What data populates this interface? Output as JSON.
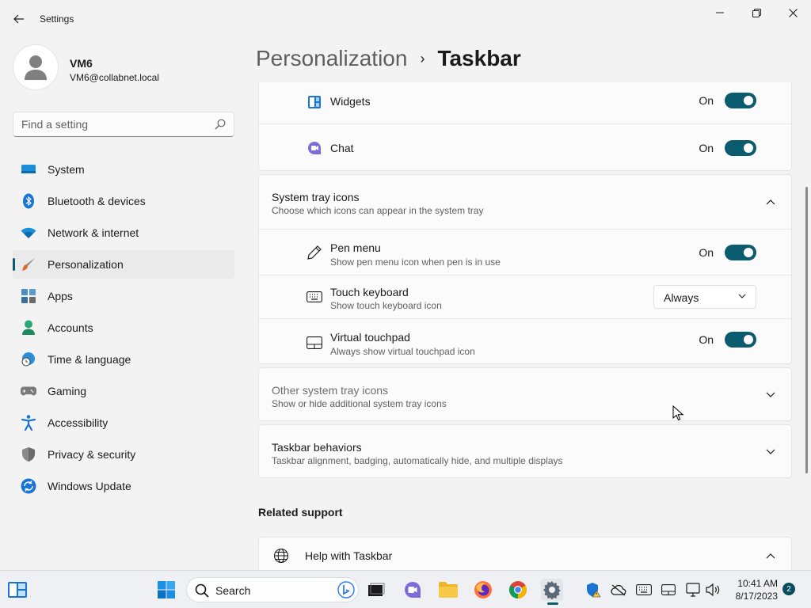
{
  "window": {
    "title": "Settings"
  },
  "profile": {
    "name": "VM6",
    "email": "VM6@collabnet.local"
  },
  "search": {
    "placeholder": "Find a setting"
  },
  "sidebar": {
    "items": [
      {
        "label": "System",
        "icon": "monitor-icon"
      },
      {
        "label": "Bluetooth & devices",
        "icon": "bluetooth-icon"
      },
      {
        "label": "Network & internet",
        "icon": "wifi-icon"
      },
      {
        "label": "Personalization",
        "icon": "brush-icon",
        "active": true
      },
      {
        "label": "Apps",
        "icon": "apps-icon"
      },
      {
        "label": "Accounts",
        "icon": "person-icon"
      },
      {
        "label": "Time & language",
        "icon": "globe-clock-icon"
      },
      {
        "label": "Gaming",
        "icon": "gamepad-icon"
      },
      {
        "label": "Accessibility",
        "icon": "accessibility-icon"
      },
      {
        "label": "Privacy & security",
        "icon": "shield-icon"
      },
      {
        "label": "Windows Update",
        "icon": "update-icon"
      }
    ]
  },
  "header": {
    "parent": "Personalization",
    "separator": "›",
    "current": "Taskbar"
  },
  "taskbar_items": {
    "widgets": {
      "label": "Widgets",
      "state": "On"
    },
    "chat": {
      "label": "Chat",
      "state": "On"
    }
  },
  "system_tray": {
    "title": "System tray icons",
    "subtitle": "Choose which icons can appear in the system tray",
    "pen_menu": {
      "title": "Pen menu",
      "subtitle": "Show pen menu icon when pen is in use",
      "state": "On"
    },
    "touch_keyboard": {
      "title": "Touch keyboard",
      "subtitle": "Show touch keyboard icon",
      "value": "Always"
    },
    "virtual_touchpad": {
      "title": "Virtual touchpad",
      "subtitle": "Always show virtual touchpad icon",
      "state": "On"
    }
  },
  "other_tray": {
    "title": "Other system tray icons",
    "subtitle": "Show or hide additional system tray icons"
  },
  "behaviors": {
    "title": "Taskbar behaviors",
    "subtitle": "Taskbar alignment, badging, automatically hide, and multiple displays"
  },
  "related": {
    "title": "Related support",
    "help": "Help with Taskbar"
  },
  "os_taskbar": {
    "search_label": "Search",
    "time": "10:41 AM",
    "date": "8/17/2023",
    "notifications": "2"
  },
  "colors": {
    "accent": "#0a5b6e",
    "background": "#f3f3f3",
    "card": "#fbfbfb"
  }
}
